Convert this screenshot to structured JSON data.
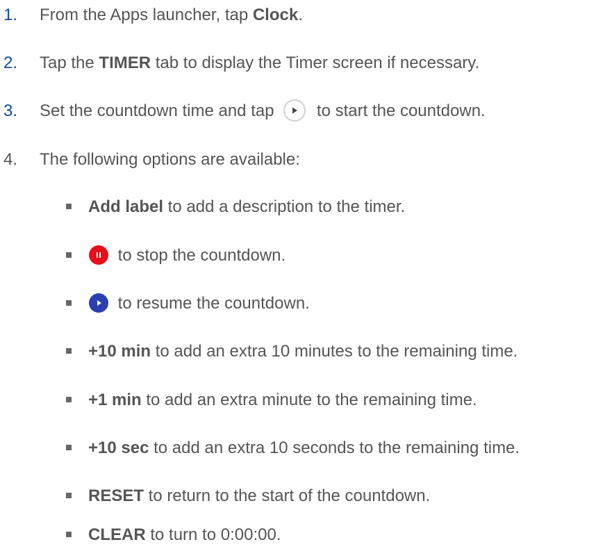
{
  "steps": [
    {
      "num": "1.",
      "before": "From the Apps launcher, tap ",
      "bold": "Clock",
      "after": "."
    },
    {
      "num": "2.",
      "before": "Tap the ",
      "bold": "TIMER",
      "after": " tab to display the Timer screen if necessary."
    },
    {
      "num": "3.",
      "before": "Set the countdown time and tap ",
      "after": " to start the countdown.",
      "icon": "play-outline-icon"
    },
    {
      "num": "4.",
      "text": "The following options are available:"
    }
  ],
  "options": [
    {
      "bold": "Add label",
      "text": " to add a description to the timer."
    },
    {
      "icon": "pause-button-icon",
      "icon_color": "#e8101a",
      "text": " to stop the countdown."
    },
    {
      "icon": "resume-button-icon",
      "icon_color": "#2a3fb0",
      "text": " to resume the countdown."
    },
    {
      "bold": "+10 min",
      "text": " to add an extra 10 minutes to the remaining time."
    },
    {
      "bold": "+1 min",
      "text": " to add an extra minute to the remaining time."
    },
    {
      "bold": "+10 sec",
      "text": " to add an extra 10 seconds to the remaining time."
    },
    {
      "bold": "RESET",
      "text": " to return to the start of the countdown."
    },
    {
      "bold": "CLEAR",
      "text": " to turn to 0:00:00."
    }
  ],
  "colors": {
    "step_number": "#0a4fa0",
    "text": "#555555",
    "pause_icon": "#e8101a",
    "resume_icon": "#2a3fb0"
  }
}
